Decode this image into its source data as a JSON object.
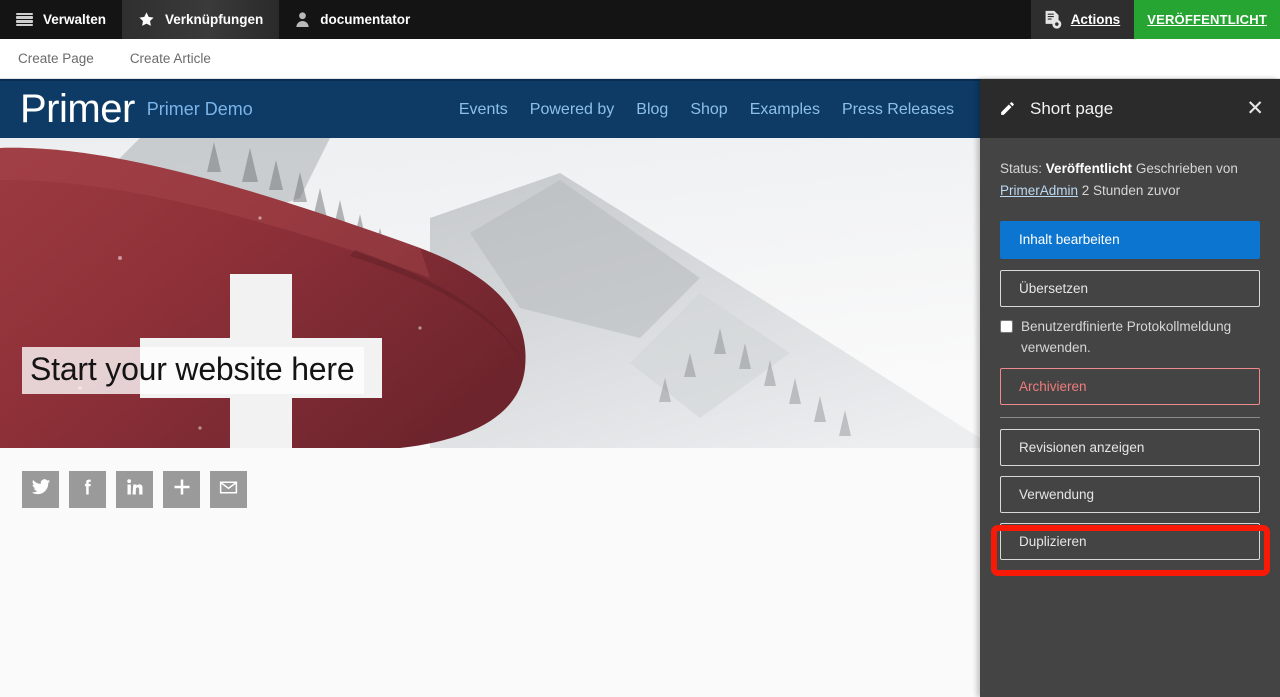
{
  "admin_bar": {
    "manage": {
      "label": "Verwalten",
      "icon": "hamburger-icon"
    },
    "shortcuts": {
      "label": "Verknüpfungen",
      "icon": "star-icon"
    },
    "user": {
      "label": "documentator",
      "icon": "user-icon"
    },
    "actions": {
      "label": "Actions",
      "icon": "document-gear-icon"
    },
    "status": {
      "label": "VERÖFFENTLICHT",
      "color": "#26a532"
    }
  },
  "create_bar": {
    "items": [
      {
        "label": "Create Page"
      },
      {
        "label": "Create Article"
      }
    ]
  },
  "site": {
    "brand": "Primer",
    "brand_sub": "Primer Demo",
    "nav": [
      {
        "label": "Events"
      },
      {
        "label": "Powered by"
      },
      {
        "label": "Blog"
      },
      {
        "label": "Shop"
      },
      {
        "label": "Examples"
      },
      {
        "label": "Press Releases"
      }
    ],
    "hero": {
      "caption": "Start your website here",
      "image_alt": "swiss-flag-mountain-photo"
    },
    "share": [
      {
        "name": "twitter-icon"
      },
      {
        "name": "facebook-icon"
      },
      {
        "name": "linkedin-icon"
      },
      {
        "name": "plus-icon"
      },
      {
        "name": "email-icon"
      }
    ]
  },
  "sidebar": {
    "title": "Short page",
    "title_icon": "pencil-icon",
    "close_icon": "close-icon",
    "status": {
      "prefix": "Status:",
      "value": "Veröffentlicht",
      "written_by": "Geschrieben von",
      "author": "PrimerAdmin",
      "time": "2 Stunden zuvor"
    },
    "buttons": {
      "edit_content": "Inhalt bearbeiten",
      "translate": "Übersetzen",
      "archive": "Archivieren",
      "show_revisions": "Revisionen anzeigen",
      "usage": "Verwendung",
      "duplicate": "Duplizieren"
    },
    "checkbox": {
      "label": "Benutzerdfinierte Protokollmeldung verwenden.",
      "checked": false
    }
  },
  "annotation": {
    "highlight_target": "Duplizieren",
    "highlight_color": "#f81a07"
  }
}
